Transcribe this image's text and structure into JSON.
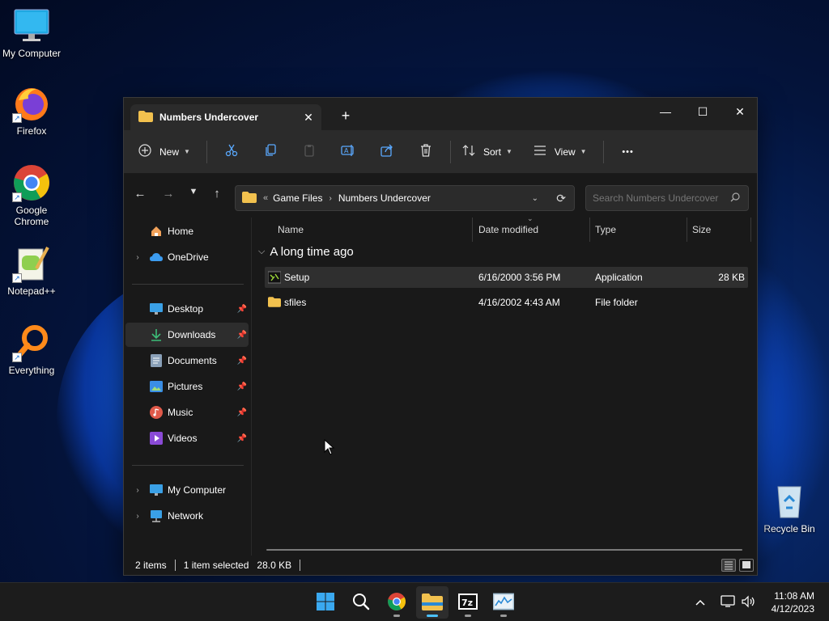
{
  "desktop": {
    "icons": [
      {
        "label": "My Computer",
        "icon": "monitor-icon"
      },
      {
        "label": "Firefox",
        "icon": "firefox-icon"
      },
      {
        "label": "Google Chrome",
        "icon": "chrome-icon"
      },
      {
        "label": "Notepad++",
        "icon": "notepadpp-icon"
      },
      {
        "label": "Everything",
        "icon": "everything-search-icon"
      },
      {
        "label": "Recycle Bin",
        "icon": "recycle-bin-icon"
      }
    ]
  },
  "window": {
    "tab_title": "Numbers Undercover",
    "tab_close": "✕",
    "new_tab": "+",
    "controls": {
      "minimize": "—",
      "maximize": "☐",
      "close": "✕"
    }
  },
  "toolbar": {
    "new_label": "New",
    "sort_label": "Sort",
    "view_label": "View",
    "more_label": "•••",
    "icons": [
      "new-plus-icon",
      "cut-icon",
      "copy-icon",
      "paste-icon",
      "rename-icon",
      "share-icon",
      "delete-icon",
      "sort-icon",
      "view-icon",
      "more-icon"
    ]
  },
  "address": {
    "overflow": "«",
    "crumbs": [
      "Game Files",
      "Numbers Undercover"
    ],
    "separator": "›",
    "search_placeholder": "Search Numbers Undercover"
  },
  "nav": {
    "home": "Home",
    "onedrive": "OneDrive",
    "pinned": [
      {
        "label": "Desktop",
        "icon": "desktop-icon"
      },
      {
        "label": "Downloads",
        "icon": "download-icon"
      },
      {
        "label": "Documents",
        "icon": "documents-icon"
      },
      {
        "label": "Pictures",
        "icon": "pictures-icon"
      },
      {
        "label": "Music",
        "icon": "music-icon"
      },
      {
        "label": "Videos",
        "icon": "videos-icon"
      }
    ],
    "my_computer": "My Computer",
    "network": "Network",
    "selected": "Downloads"
  },
  "columns": {
    "name": "Name",
    "date": "Date modified",
    "type": "Type",
    "size": "Size"
  },
  "group_label": "A long time ago",
  "files": [
    {
      "name": "Setup",
      "date": "6/16/2000 3:56 PM",
      "type": "Application",
      "size": "28 KB",
      "selected": true
    },
    {
      "name": "sfiles",
      "date": "4/16/2002 4:43 AM",
      "type": "File folder",
      "size": "",
      "selected": false
    }
  ],
  "status": {
    "items": "2 items",
    "selected": "1 item selected",
    "size": "28.0 KB"
  },
  "taskbar": {
    "apps": [
      "start-icon",
      "search-icon",
      "chrome-icon",
      "file-explorer-icon",
      "7zip-icon",
      "resource-monitor-icon"
    ],
    "time": "11:08 AM",
    "date": "4/12/2023",
    "tray_chevron": "^"
  },
  "colors": {
    "accent": "#4cc2ff",
    "folder": "#f2c14e",
    "window_bg": "#191919",
    "toolbar_bg": "#2b2b2b"
  }
}
